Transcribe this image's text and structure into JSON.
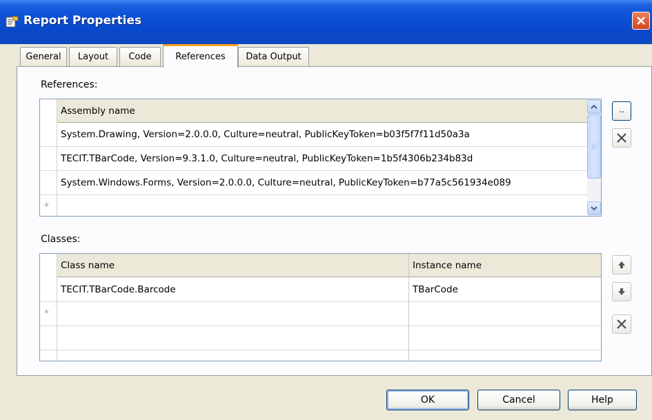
{
  "window": {
    "title": "Report Properties",
    "icon": "report-properties-icon",
    "close_icon": "close-icon"
  },
  "tabs": [
    {
      "label": "General",
      "active": false
    },
    {
      "label": "Layout",
      "active": false
    },
    {
      "label": "Code",
      "active": false
    },
    {
      "label": "References",
      "active": true
    },
    {
      "label": "Data Output",
      "active": false
    }
  ],
  "references": {
    "label": "References:",
    "column_header": "Assembly name",
    "rows": [
      "System.Drawing, Version=2.0.0.0, Culture=neutral, PublicKeyToken=b03f5f7f11d50a3a",
      "TECIT.TBarCode, Version=9.3.1.0, Culture=neutral, PublicKeyToken=1b5f4306b234b83d",
      "System.Windows.Forms, Version=2.0.0.0, Culture=neutral, PublicKeyToken=b77a5c561934e089"
    ],
    "new_row_marker": "*",
    "browse_button": "..",
    "delete_icon": "delete-x-icon"
  },
  "classes": {
    "label": "Classes:",
    "headers": [
      "Class name",
      "Instance name"
    ],
    "rows": [
      {
        "class_name": "TECIT.TBarCode.Barcode",
        "instance_name": "TBarCode"
      }
    ],
    "new_row_marker": "*",
    "move_up_icon": "arrow-up-icon",
    "move_down_icon": "arrow-down-icon",
    "delete_icon": "delete-x-icon"
  },
  "footer": {
    "ok": "OK",
    "cancel": "Cancel",
    "help": "Help"
  }
}
